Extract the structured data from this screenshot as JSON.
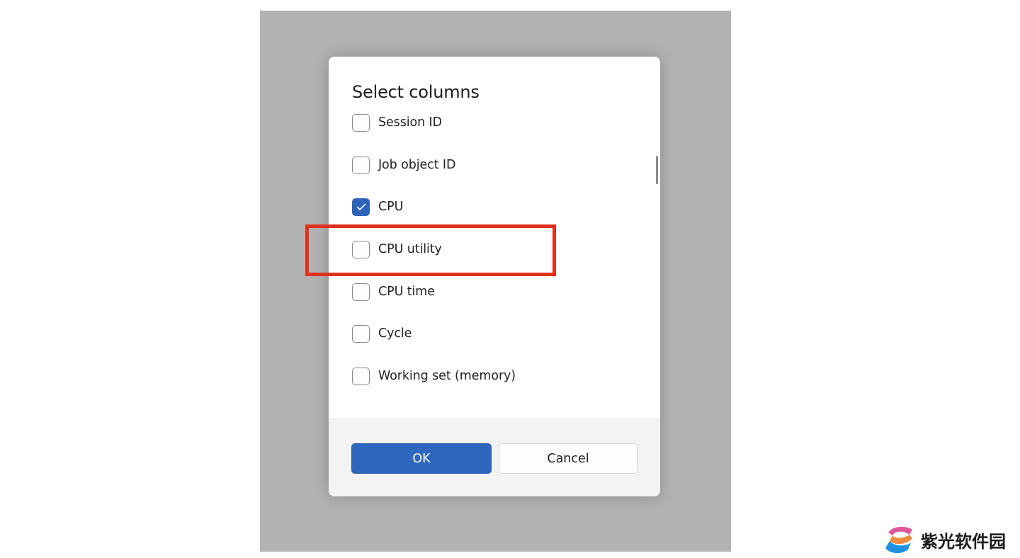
{
  "dialog": {
    "title": "Select columns",
    "columns": [
      {
        "label": "Session ID",
        "checked": false
      },
      {
        "label": "Job object ID",
        "checked": false
      },
      {
        "label": "CPU",
        "checked": true
      },
      {
        "label": "CPU utility",
        "checked": false
      },
      {
        "label": "CPU time",
        "checked": false
      },
      {
        "label": "Cycle",
        "checked": false
      },
      {
        "label": "Working set (memory)",
        "checked": false
      }
    ],
    "buttons": {
      "ok": "OK",
      "cancel": "Cancel"
    }
  },
  "annotation": {
    "highlighted_item": "CPU utility",
    "color": "#e0301e"
  },
  "watermark": {
    "text": "紫光软件园"
  },
  "colors": {
    "accent": "#2f67bf",
    "backdrop": "#b2b2b2",
    "footer": "#f3f3f3"
  },
  "icons": {
    "checked": "checkmark-icon"
  }
}
